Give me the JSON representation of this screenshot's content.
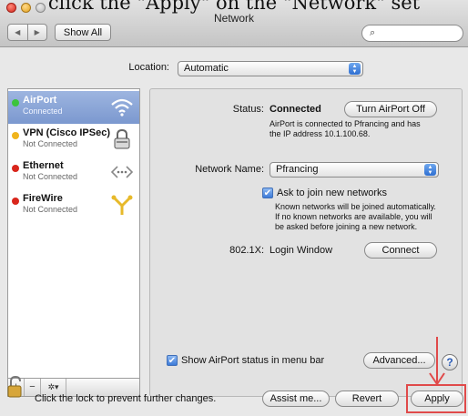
{
  "caption": "click the \"Apply\" on the \"Network\" set",
  "window": {
    "title": "Network",
    "show_all_label": "Show All",
    "search_placeholder": "",
    "search_icon": "magnifier-icon"
  },
  "location": {
    "label": "Location:",
    "value": "Automatic"
  },
  "services": [
    {
      "name": "AirPort",
      "status": "Connected",
      "dot_color": "#3cc43c",
      "icon": "wifi-icon",
      "selected": true
    },
    {
      "name": "VPN (Cisco IPSec)",
      "status": "Not Connected",
      "dot_color": "#f0b41c",
      "icon": "lock-icon",
      "selected": false
    },
    {
      "name": "Ethernet",
      "status": "Not Connected",
      "dot_color": "#d9261c",
      "icon": "ethernet-icon",
      "selected": false
    },
    {
      "name": "FireWire",
      "status": "Not Connected",
      "dot_color": "#d9261c",
      "icon": "firewire-icon",
      "selected": false
    }
  ],
  "sidebar_controls": {
    "add": "+",
    "remove": "−",
    "action": "✲▾"
  },
  "detail": {
    "status_label": "Status:",
    "status_value": "Connected",
    "turn_off_label": "Turn AirPort Off",
    "status_desc_1": "AirPort is connected to Pfrancing and has",
    "status_desc_2": "the IP address 10.1.100.68.",
    "network_name_label": "Network Name:",
    "network_name_value": "Pfrancing",
    "ask_join_label": "Ask to join new networks",
    "ask_join_desc_1": "Known networks will be joined automatically.",
    "ask_join_desc_2": "If no known networks are available, you will",
    "ask_join_desc_3": "be asked before joining a new network.",
    "dot1x_label": "802.1X:",
    "dot1x_value": "Login Window",
    "connect_label": "Connect",
    "show_status_label": "Show AirPort status in menu bar",
    "advanced_label": "Advanced...",
    "help_label": "?"
  },
  "footer": {
    "lock_text": "Click the lock to prevent further changes.",
    "assist_label": "Assist me...",
    "revert_label": "Revert",
    "apply_label": "Apply"
  },
  "colors": {
    "highlight_box": "#e04a4a",
    "arrow": "#e04a4a",
    "selection": "#7b98cf"
  }
}
